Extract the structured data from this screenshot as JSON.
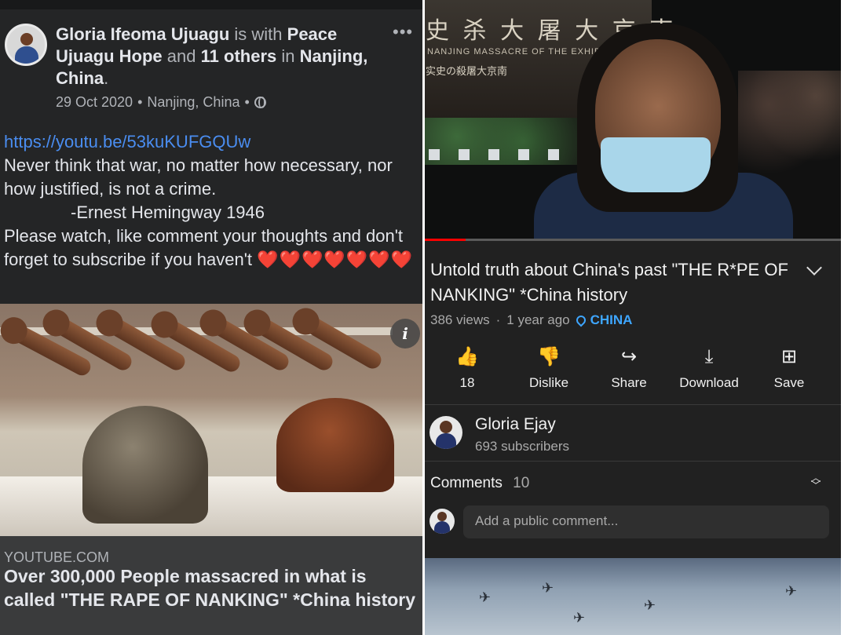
{
  "facebook": {
    "author": "Gloria Ifeoma Ujuagu",
    "with_text": "is with",
    "tagged_person": "Peace Ujuagu Hope",
    "and_text": "and",
    "others": "11 others",
    "in_text": "in",
    "location": "Nanjing, China",
    "date": "29 Oct 2020",
    "date_location": "Nanjing, China",
    "separator": "•",
    "more": "•••",
    "post_link": "https://youtu.be/53kuKUFGQUw",
    "post_line1": "Never think that war, no matter how necessary, nor how justified, is not a crime.",
    "post_line2": "-Ernest Hemingway 1946",
    "post_line3": "Please watch, like comment your thoughts and don't forget to subscribe if you haven't",
    "hearts": "❤️❤️❤️❤️❤️❤️❤️",
    "info_icon": "i",
    "link_domain": "YOUTUBE.COM",
    "link_title": "Over 300,000 People massacred in what is called \"THE RAPE OF NANKING\" *China history"
  },
  "youtube": {
    "video_wall_cn": "史 杀 大 屠 大 京 南",
    "video_wall_en": "NANJING MASSACRE OF THE EXHIBITION",
    "video_wall_cn2": "实史の殺屠大京南",
    "progress": 0.1,
    "title": "Untold truth about China's past \"THE R*PE OF NANKING\" *China history",
    "views": "386 views",
    "dot": "·",
    "age": "1 year ago",
    "location": "CHINA",
    "actions": [
      {
        "label": "18",
        "icon": "thumbs-up-icon"
      },
      {
        "label": "Dislike",
        "icon": "thumbs-down-icon"
      },
      {
        "label": "Share",
        "icon": "share-icon"
      },
      {
        "label": "Download",
        "icon": "download-icon"
      },
      {
        "label": "Save",
        "icon": "save-playlist-icon"
      }
    ],
    "channel_name": "Gloria Ejay",
    "subscribers": "693 subscribers",
    "comments_label": "Comments",
    "comments_count": "10",
    "comment_placeholder": "Add a public comment..."
  },
  "colors": {
    "fb_bg": "#242526",
    "yt_bg": "#212121",
    "link_blue": "#4a8df0",
    "yt_accent": "#3ea6ff",
    "yt_red": "#ff0000"
  }
}
